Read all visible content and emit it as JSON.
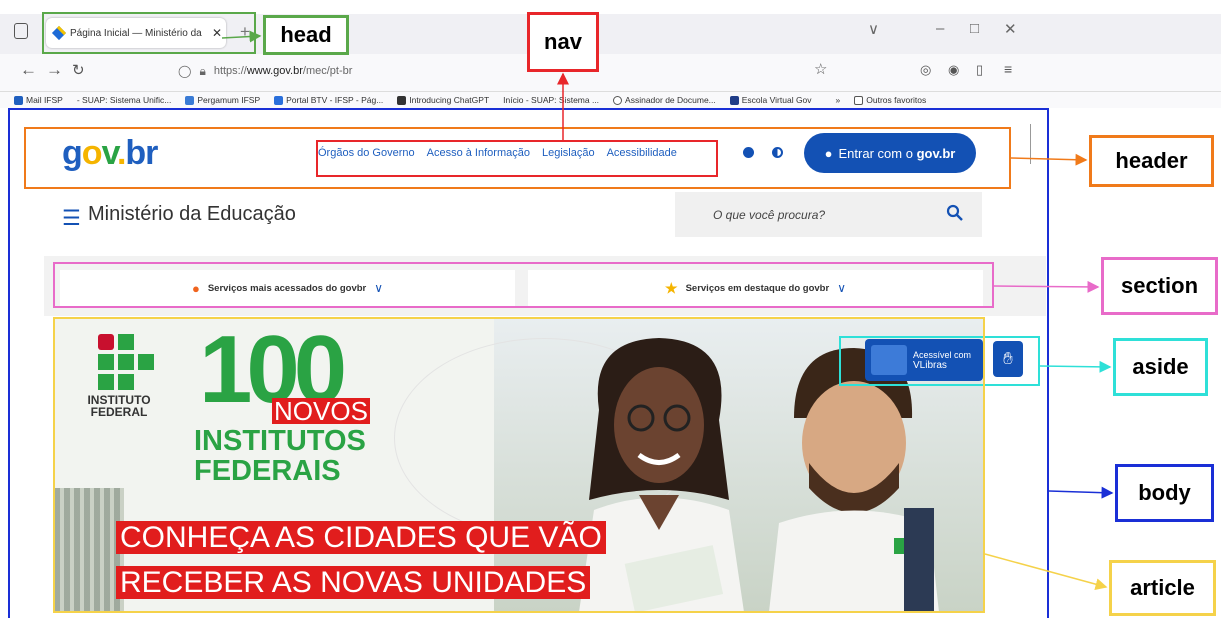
{
  "browser": {
    "tab_title": "Página Inicial — Ministério da E",
    "tab_close": "✕",
    "new_tab": "+",
    "url_prefix": "https://",
    "url_domain": "www.gov.br",
    "url_path": "/mec/pt-br",
    "bookmarks": [
      "Mail IFSP",
      "- SUAP: Sistema Unific...",
      "Pergamum IFSP",
      "Portal BTV - IFSP - Pág...",
      "Introducing ChatGPT",
      "Início - SUAP: Sistema ...",
      "Assinador de Docume...",
      "Escola Virtual Gov"
    ],
    "bookmarks_overflow": "»",
    "other_favorites": "Outros favoritos",
    "controls": {
      "minimize": "–",
      "maximize": "□",
      "close": "✕",
      "dropdown": "∨"
    }
  },
  "header": {
    "logo": {
      "g": "g",
      "o": "o",
      "v": "v",
      "dot": ".",
      "br": "br"
    },
    "nav": [
      "Órgãos do Governo",
      "Acesso à Informação",
      "Legislação",
      "Acessibilidade"
    ],
    "login_text": "Entrar com o",
    "login_bold": "gov.br"
  },
  "ministry": {
    "menu_icon": "☰",
    "title": "Ministério da Educação"
  },
  "search": {
    "placeholder": "O que você procura?"
  },
  "services": {
    "most_accessed": "Serviços mais acessados do govbr",
    "featured": "Serviços em destaque do govbr"
  },
  "banner": {
    "if_label_1": "INSTITUTO",
    "if_label_2": "FEDERAL",
    "big_number": "100",
    "novos": "NOVOS",
    "institutos": "INSTITUTOS",
    "federais": "FEDERAIS",
    "line1": "CONHEÇA AS CIDADES QUE VÃO",
    "line2": "RECEBER AS NOVAS UNIDADES"
  },
  "vlibras": {
    "line1": "Acessível com",
    "line2": "VLibras"
  },
  "annotations": {
    "head": "head",
    "nav": "nav",
    "header": "header",
    "section": "section",
    "aside": "aside",
    "body": "body",
    "article": "article"
  },
  "colors": {
    "head": "#5aa84a",
    "nav": "#e8262a",
    "header": "#f07a1a",
    "section": "#e86bc9",
    "aside": "#2ee0d8",
    "body": "#1a2fd6",
    "article": "#f5d24a",
    "govbr_blue": "#1351b4"
  }
}
